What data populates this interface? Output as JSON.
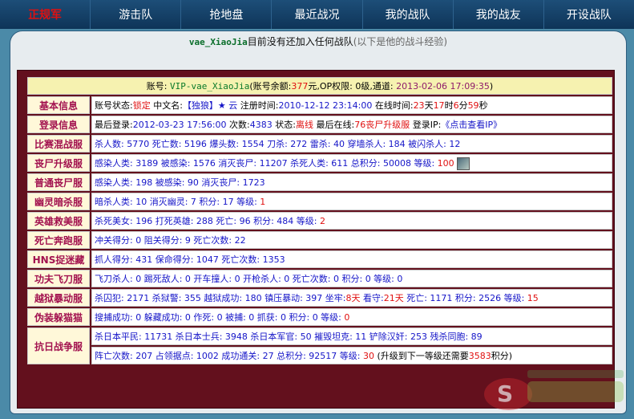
{
  "nav": {
    "items": [
      "正规军",
      "游击队",
      "抢地盘",
      "最近战况",
      "我的战队",
      "我的战友",
      "开设战队"
    ]
  },
  "header": {
    "username": "vae_XiaoJia",
    "status": "目前没有还加入任何战队",
    "note": "(以下是他的战斗经验)"
  },
  "account": {
    "label": "账号:",
    "vip": "VIP-vae_XiaoJia",
    "balance_label": "(账号余额:",
    "balance": "377",
    "balance_suffix": "元,",
    "op": "OP权限: 0级,",
    "channel": "通道:",
    "date": "2013-02-06 17:09:35",
    "close": ")"
  },
  "basic": {
    "label": "基本信息",
    "status_label": "账号状态:",
    "status": "锁定",
    "cname_label": "中文名:",
    "cname": "【独狼】★ 云",
    "reg_label": "注册时间:",
    "reg": "2010-12-12 23:14:00",
    "online_label": "在线时间:",
    "d": "23",
    "d_u": "天",
    "h": "17",
    "h_u": "时",
    "m": "6",
    "m_u": "分",
    "s": "59",
    "s_u": "秒"
  },
  "login": {
    "label": "登录信息",
    "last_label": "最后登录:",
    "last": "2012-03-23 17:56:00",
    "count_label": "次数:",
    "count": "4383",
    "state_label": "状态:",
    "state": "离线",
    "laston_label": "最后在线:",
    "laston": "76丧尸升级服",
    "ip_label": "登录IP:",
    "ip": "《点击查看IP》"
  },
  "rows": {
    "mix": {
      "label": "比赛混战服",
      "text": "杀人数: 5770 死亡数: 5196 爆头数: 1554 刀杀: 272 雷杀: 40 穿墙杀人: 184 被闪杀人: 12"
    },
    "zombie_up": {
      "label": "丧尸升级服",
      "text": "感染人类: 3189 被感染: 1576 消灭丧尸: 11207 杀死人类: 611 总积分: 50008 等级:",
      "level": "100"
    },
    "zombie": {
      "label": "普通丧尸服",
      "text": "感染人类: 198 被感染: 90 消灭丧尸: 1723"
    },
    "ghost": {
      "label": "幽灵暗杀服",
      "text": "暗杀人类: 10 消灭幽灵: 7 积分: 17 等级:",
      "level": "1"
    },
    "hero": {
      "label": "英雄救美服",
      "text": "杀死美女: 196 打死英雄: 288 死亡: 96 积分: 484 等级:",
      "level": "2"
    },
    "death": {
      "label": "死亡奔跑服",
      "text": "冲关得分: 0 阻关得分: 9 死亡次数: 22"
    },
    "hns": {
      "label": "HNS捉迷藏",
      "text": "抓人得分: 431 保命得分: 1047 死亡次数: 1353"
    },
    "kungfu": {
      "label": "功夫飞刀服",
      "text": "飞刀杀人: 0 踢死敌人: 0 开车撞人: 0 开枪杀人: 0 死亡次数: 0 积分: 0 等级: 0"
    },
    "jail": {
      "label": "越狱暴动服",
      "text": "杀囚犯: 2171 杀狱警: 355 越狱成功: 180 镇压暴动: 397 坐牢:",
      "sit": "8天",
      "look_label": "看守:",
      "look": "21天",
      "rest": "死亡: 1171 积分: 2526 等级:",
      "level": "15"
    },
    "hide": {
      "label": "伪装躲猫猫",
      "text": "搜捕成功: 0 躲藏成功: 0 作死: 0 被捕: 0 抓获: 0 积分: 0 等级:",
      "level": "0"
    },
    "war": {
      "label": "抗日战争服",
      "line1": "杀日本平民: 11731 杀日本士兵: 3948 杀日本军官: 50 摧毁坦克: 11 铲除汉奸: 253 残杀同胞: 89",
      "line2": "阵亡次数: 207 占领据点: 1002 成功通关: 27 总积分: 92517 等级:",
      "level": "30",
      "upgrade": "(升级到下一等级还需要",
      "need": "3583",
      "need_suffix": "积分)"
    }
  }
}
